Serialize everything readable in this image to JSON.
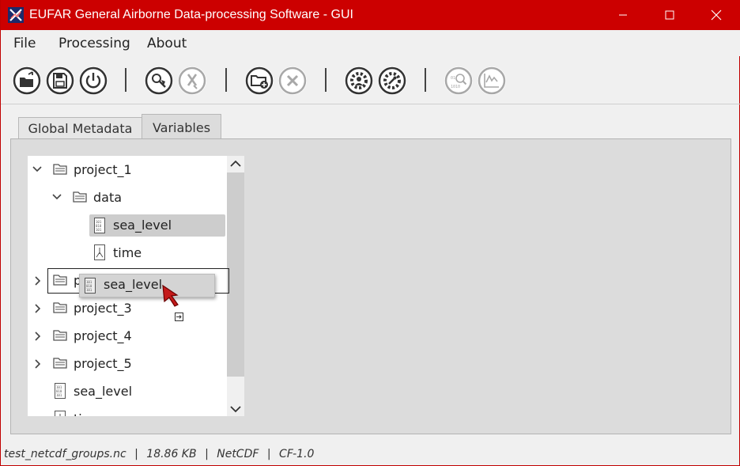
{
  "window": {
    "title": "EUFAR General Airborne Data-processing Software - GUI",
    "accent_color": "#cc0000",
    "controls": {
      "minimize_icon": "minimize-icon",
      "maximize_icon": "maximize-icon",
      "close_icon": "close-icon"
    }
  },
  "menu": {
    "file": "File",
    "processing": "Processing",
    "about": "About"
  },
  "toolbar": {
    "buttons": [
      {
        "name": "open-file-icon",
        "enabled": true
      },
      {
        "name": "save-file-icon",
        "enabled": true
      },
      {
        "name": "power-icon",
        "enabled": true
      },
      {
        "name": "search-tag-icon",
        "enabled": true
      },
      {
        "name": "clear-search-icon",
        "enabled": false
      },
      {
        "name": "add-folder-icon",
        "enabled": true
      },
      {
        "name": "remove-icon",
        "enabled": false
      },
      {
        "name": "user-settings-icon",
        "enabled": true
      },
      {
        "name": "wrench-settings-icon",
        "enabled": true
      },
      {
        "name": "data-inspect-icon",
        "enabled": false
      },
      {
        "name": "plot-icon",
        "enabled": false
      }
    ]
  },
  "tabs": {
    "global_metadata": "Global Metadata",
    "variables": "Variables",
    "active": "Variables"
  },
  "tree": {
    "project_1": "project_1",
    "data": "data",
    "sea_level_nested": "sea_level",
    "time_nested": "time",
    "project_2_partial": "p",
    "project_3": "project_3",
    "project_4": "project_4",
    "project_5": "project_5",
    "sea_level_root": "sea_level",
    "time_root_partial": "ti"
  },
  "drag": {
    "label": "sea_level"
  },
  "status": {
    "filename": "test_netcdf_groups.nc",
    "size": "18.86 KB",
    "format": "NetCDF",
    "convention": "CF-1.0",
    "separator": "|"
  }
}
